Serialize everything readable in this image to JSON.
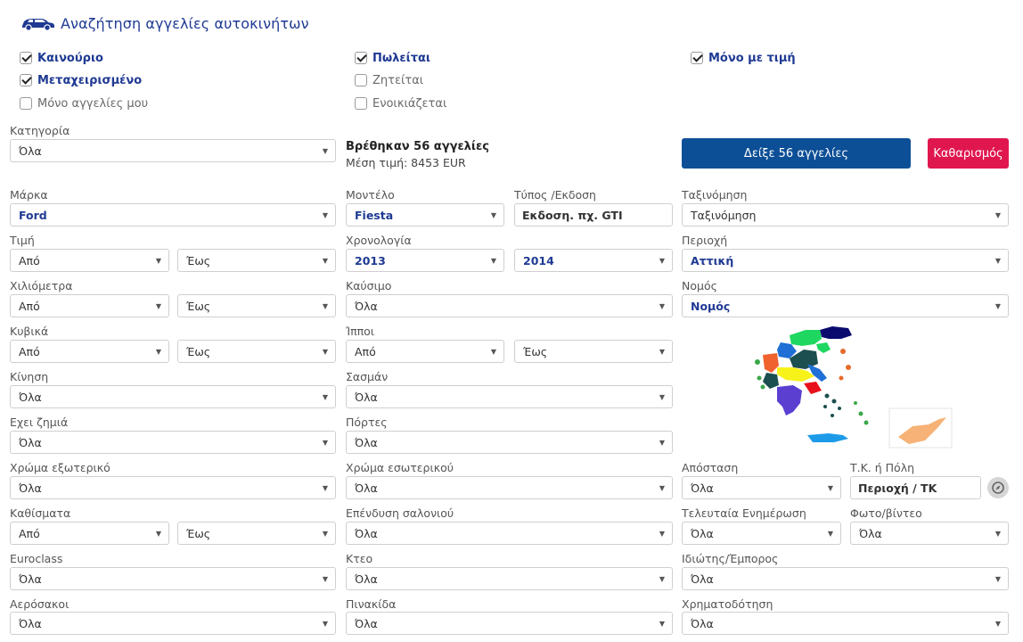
{
  "header": {
    "title": "Αναζήτηση αγγελίες αυτοκινήτων"
  },
  "filters": {
    "new": {
      "label": "Καινούριο",
      "checked": true
    },
    "used": {
      "label": "Μεταχειρισμένο",
      "checked": true
    },
    "mine": {
      "label": "Μόνο αγγελίες μου",
      "checked": false
    },
    "sale": {
      "label": "Πωλείται",
      "checked": true
    },
    "wanted": {
      "label": "Ζητείται",
      "checked": false
    },
    "rent": {
      "label": "Ενοικιάζεται",
      "checked": false
    },
    "price_only": {
      "label": "Μόνο με τιμή",
      "checked": true
    }
  },
  "category": {
    "label": "Κατηγορία",
    "value": "Όλα"
  },
  "results": {
    "found": "Βρέθηκαν 56 αγγελίες",
    "avg": "Μέση τιμή: 8453 EUR"
  },
  "buttons": {
    "show": "Δείξε 56 αγγελίες",
    "clear": "Καθαρισμός"
  },
  "fields": {
    "make": {
      "label": "Μάρκα",
      "value": "Ford"
    },
    "model": {
      "label": "Μοντέλο",
      "value": "Fiesta"
    },
    "version": {
      "label": "Τύπος /Εκδοση",
      "value": "Εκδοση. πχ. GTI"
    },
    "sort": {
      "label": "Ταξινόμηση",
      "value": "Ταξινόμηση"
    },
    "price": {
      "label": "Τιμή",
      "from": "Από",
      "to": "Έως"
    },
    "year": {
      "label": "Χρονολογία",
      "from": "2013",
      "to": "2014"
    },
    "region": {
      "label": "Περιοχή",
      "value": "Αττική"
    },
    "km": {
      "label": "Χιλιόμετρα",
      "from": "Από",
      "to": "Έως"
    },
    "fuel": {
      "label": "Καύσιμο",
      "value": "Όλα"
    },
    "prefecture": {
      "label": "Νομός",
      "value": "Νομός"
    },
    "cc": {
      "label": "Κυβικά",
      "from": "Από",
      "to": "Έως"
    },
    "hp": {
      "label": "Ίπποι",
      "from": "Από",
      "to": "Έως"
    },
    "drive": {
      "label": "Κίνηση",
      "value": "Όλα"
    },
    "chassis": {
      "label": "Σασμάν",
      "value": "Όλα"
    },
    "damage": {
      "label": "Εχει ζημιά",
      "value": "Όλα"
    },
    "doors": {
      "label": "Πόρτες",
      "value": "Όλα"
    },
    "ext_color": {
      "label": "Χρώμα εξωτερικό",
      "value": "Όλα"
    },
    "int_color": {
      "label": "Χρώμα εσωτερικού",
      "value": "Όλα"
    },
    "distance": {
      "label": "Απόσταση",
      "value": "Όλα"
    },
    "zip": {
      "label": "Τ.Κ. ή Πόλη",
      "value": "Περιοχή / ΤΚ"
    },
    "seats": {
      "label": "Καθίσματα",
      "from": "Από",
      "to": "Έως"
    },
    "upholstery": {
      "label": "Επένδυση σαλονιού",
      "value": "Όλα"
    },
    "updated": {
      "label": "Τελευταία Ενημέρωση",
      "value": "Όλα"
    },
    "photo": {
      "label": "Φωτο/βίντεο",
      "value": "Όλα"
    },
    "euroclass": {
      "label": "Euroclass",
      "value": "Όλα"
    },
    "kteo": {
      "label": "Κτεο",
      "value": "Όλα"
    },
    "seller": {
      "label": "Ιδιώτης/Έμπορος",
      "value": "Όλα"
    },
    "airbags": {
      "label": "Αερόσακοι",
      "value": "Όλα"
    },
    "plate": {
      "label": "Πινακίδα",
      "value": "Όλα"
    },
    "finance": {
      "label": "Χρηματοδότηση",
      "value": "Όλα"
    }
  },
  "icons": {
    "car": "car-icon",
    "arrow": "chevron-down-icon",
    "compass": "compass-icon",
    "map": "greece-map"
  }
}
